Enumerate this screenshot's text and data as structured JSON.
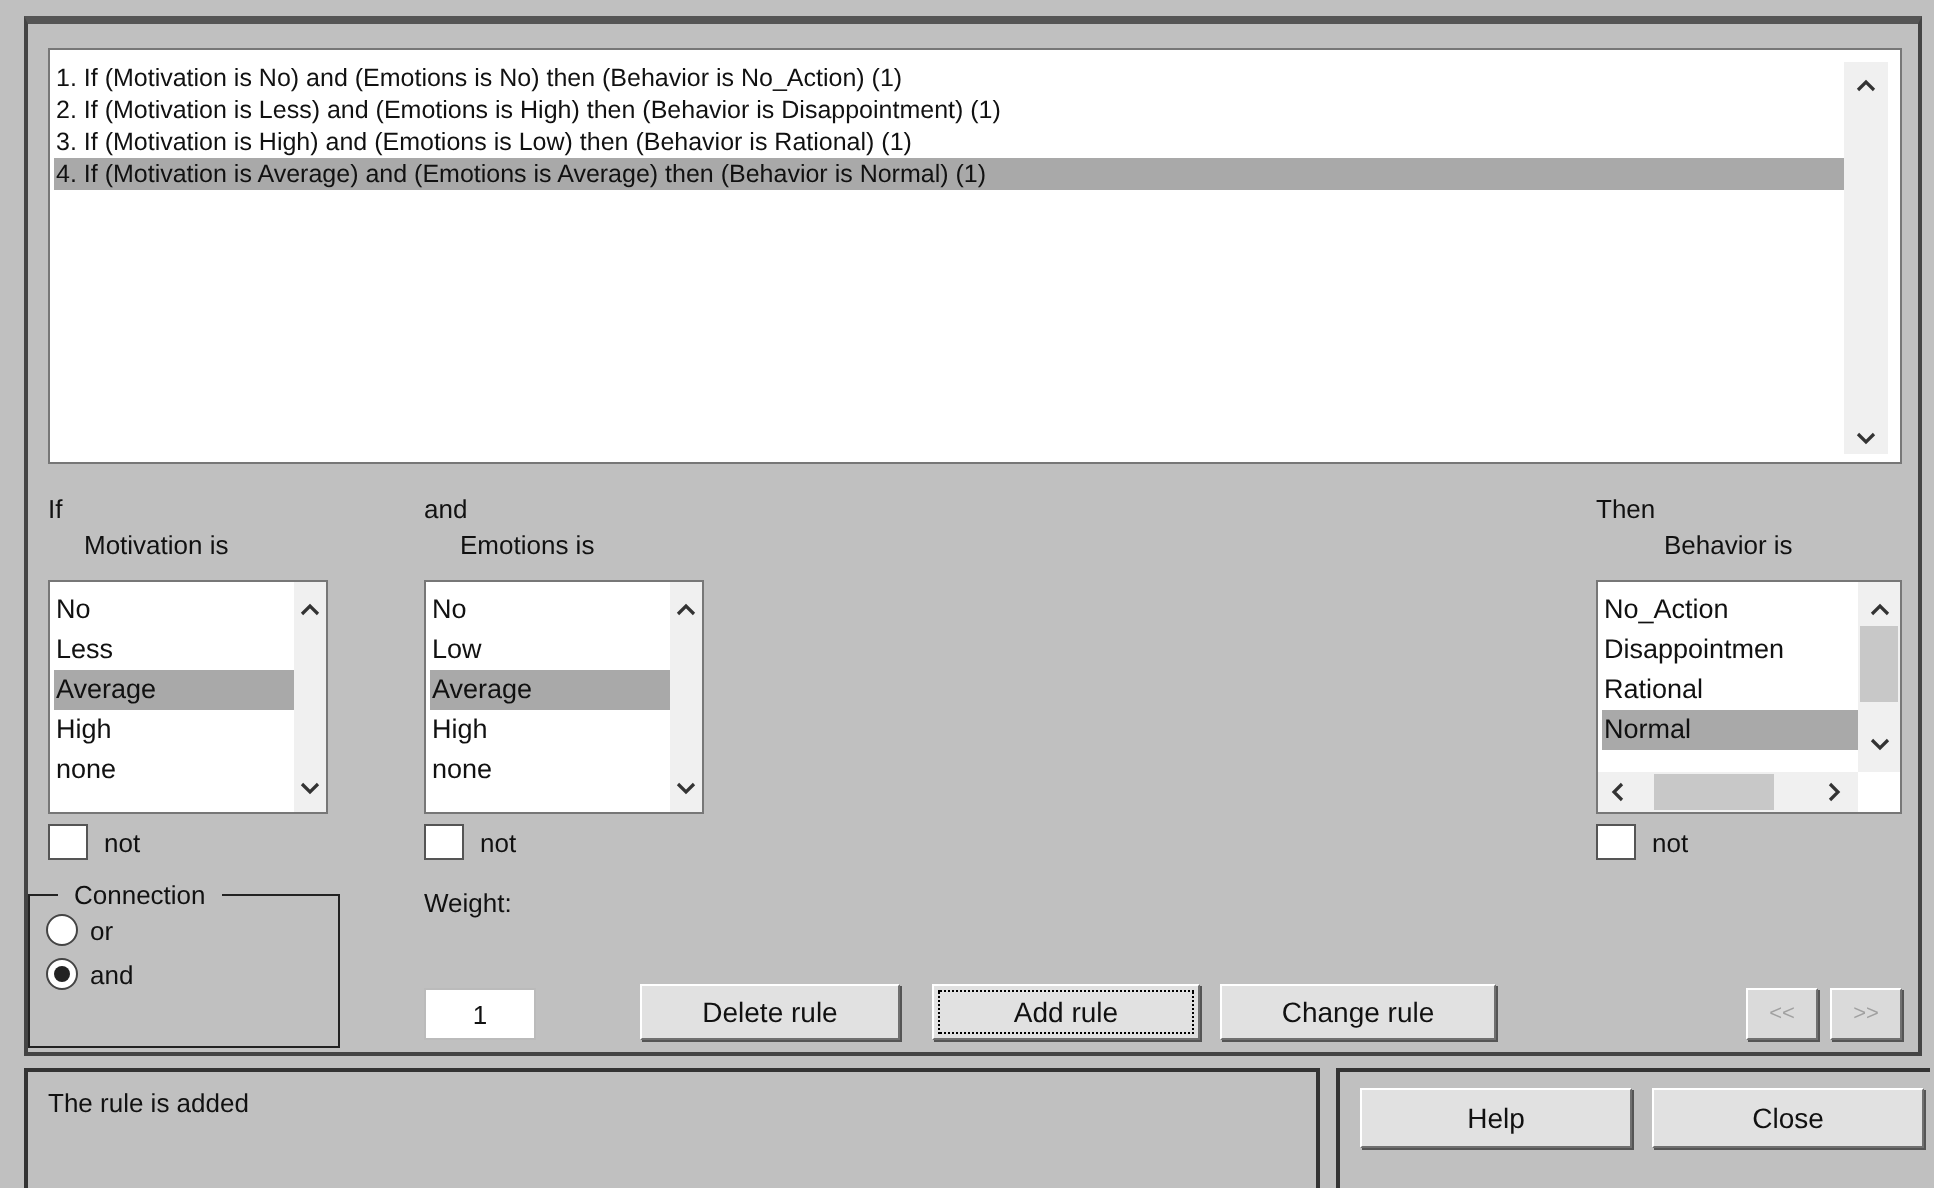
{
  "rules": {
    "items": [
      {
        "text": "1. If (Motivation is No) and (Emotions is No) then (Behavior is No_Action) (1)",
        "selected": false
      },
      {
        "text": "2. If (Motivation is Less) and (Emotions is High) then (Behavior is Disappointment) (1)",
        "selected": false
      },
      {
        "text": "3. If (Motivation is High) and (Emotions is Low) then (Behavior is Rational) (1)",
        "selected": false
      },
      {
        "text": "4. If (Motivation is Average) and (Emotions is Average) then (Behavior is Normal) (1)",
        "selected": true
      }
    ]
  },
  "antecedents": [
    {
      "heading": "If",
      "variable": "Motivation is",
      "options": [
        {
          "label": "No",
          "selected": false
        },
        {
          "label": "Less",
          "selected": false
        },
        {
          "label": "Average",
          "selected": true
        },
        {
          "label": "High",
          "selected": false
        },
        {
          "label": "none",
          "selected": false
        }
      ],
      "not": {
        "label": "not",
        "checked": false
      }
    },
    {
      "heading": "and",
      "variable": "Emotions is",
      "options": [
        {
          "label": "No",
          "selected": false
        },
        {
          "label": "Low",
          "selected": false
        },
        {
          "label": "Average",
          "selected": true
        },
        {
          "label": "High",
          "selected": false
        },
        {
          "label": "none",
          "selected": false
        }
      ],
      "not": {
        "label": "not",
        "checked": false
      }
    }
  ],
  "consequent": {
    "heading": "Then",
    "variable": "Behavior is",
    "options": [
      {
        "label": "No_Action",
        "selected": false
      },
      {
        "label": "Disappointmen",
        "selected": false
      },
      {
        "label": "Rational",
        "selected": false
      },
      {
        "label": "Normal",
        "selected": true
      }
    ],
    "not": {
      "label": "not",
      "checked": false
    }
  },
  "connection": {
    "title": "Connection",
    "options": [
      {
        "label": "or",
        "selected": false
      },
      {
        "label": "and",
        "selected": true
      }
    ]
  },
  "weight": {
    "label": "Weight:",
    "value": "1"
  },
  "buttons": [
    {
      "label": "Delete rule",
      "focused": false
    },
    {
      "label": "Add rule",
      "focused": true
    },
    {
      "label": "Change rule",
      "focused": false
    }
  ],
  "nav_buttons": [
    {
      "label": "<<",
      "disabled": true
    },
    {
      "label": ">>",
      "disabled": true
    }
  ],
  "status": "The rule is added",
  "footer_buttons": [
    {
      "label": "Help"
    },
    {
      "label": "Close"
    }
  ]
}
